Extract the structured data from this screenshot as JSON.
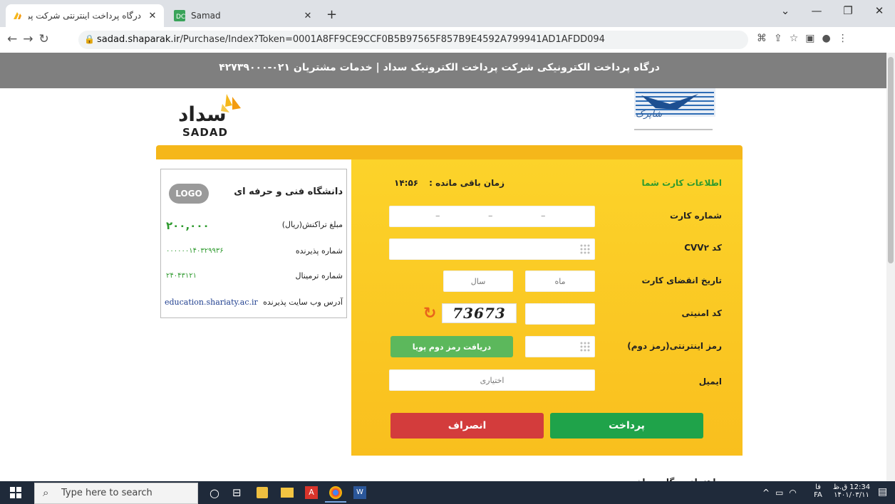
{
  "browser": {
    "tabs": [
      {
        "title": "درگاه پرداخت اینترنتی شرکت پرداخت",
        "close": "✕"
      },
      {
        "title": "Samad",
        "close": "✕"
      }
    ],
    "new_tab": "+",
    "url_host": "sadad.shaparak.ir",
    "url_path": "/Purchase/Index?Token=0001A8FF9CE9CCF0B5B97565F857B9E4592A799941AD1AFDD094"
  },
  "header": {
    "text": "درگاه پرداخت الکترونیکی شرکت پرداخت الکترونیک سداد | خدمات مشتریان ۰۲۱-۴۲۷۳۹۰۰۰"
  },
  "logos": {
    "sadad_fa": "سداد",
    "sadad_en": "SADAD",
    "shaparak": "شاپرک"
  },
  "merchant": {
    "logo_text": "LOGO",
    "name": "دانشگاه فنی و حرفه ای",
    "amount_label": "مبلغ تراکنش(ریال)",
    "amount_value": "۲۰۰,۰۰۰",
    "acceptor_label": "شماره پذیرنده",
    "acceptor_value": "۰۰۰۰۰۰۱۴۰۳۲۹۹۳۶",
    "terminal_label": "شماره ترمینال",
    "terminal_value": "۲۴۰۴۳۱۲۱",
    "website_label": "آدرس وب سایت پذیرنده",
    "website_value": "education.shariaty.ac.ir"
  },
  "form": {
    "card_info_title": "اطلاعات کارت شما",
    "timer_label": "زمان باقی مانده :",
    "timer_value": "۱۴:۵۶",
    "card_number_label": "شماره کارت",
    "cvv2_label": "کد CVV۲",
    "expiry_label": "تاریخ انقضای کارت",
    "month_placeholder": "ماه",
    "year_placeholder": "سال",
    "captcha_label": "کد امنیتی",
    "captcha_value": "73673",
    "password_label": "رمز اینترنتی(رمز دوم)",
    "get_otp_button": "دریافت رمز دوم پویا",
    "email_label": "ایمیل",
    "email_placeholder": "اختیاری",
    "pay_button": "پرداخت",
    "cancel_button": "انصراف",
    "guide_text": "راهنمای درگاه پرداخت"
  },
  "taskbar": {
    "search_placeholder": "Type here to search",
    "lang_top": "فا",
    "lang_bottom": "FA",
    "time": "12:34 ق.ظ",
    "date": "۱۴۰۱/۰۳/۱۱"
  },
  "colors": {
    "header_gray": "#7f7f7f",
    "form_yellow": "#fcd32a",
    "strip_orange": "#f5b71a",
    "pay_green": "#1fa34a",
    "cancel_red": "#d33c3c",
    "otp_green": "#5cb85c",
    "title_green": "#2e9a2e"
  }
}
